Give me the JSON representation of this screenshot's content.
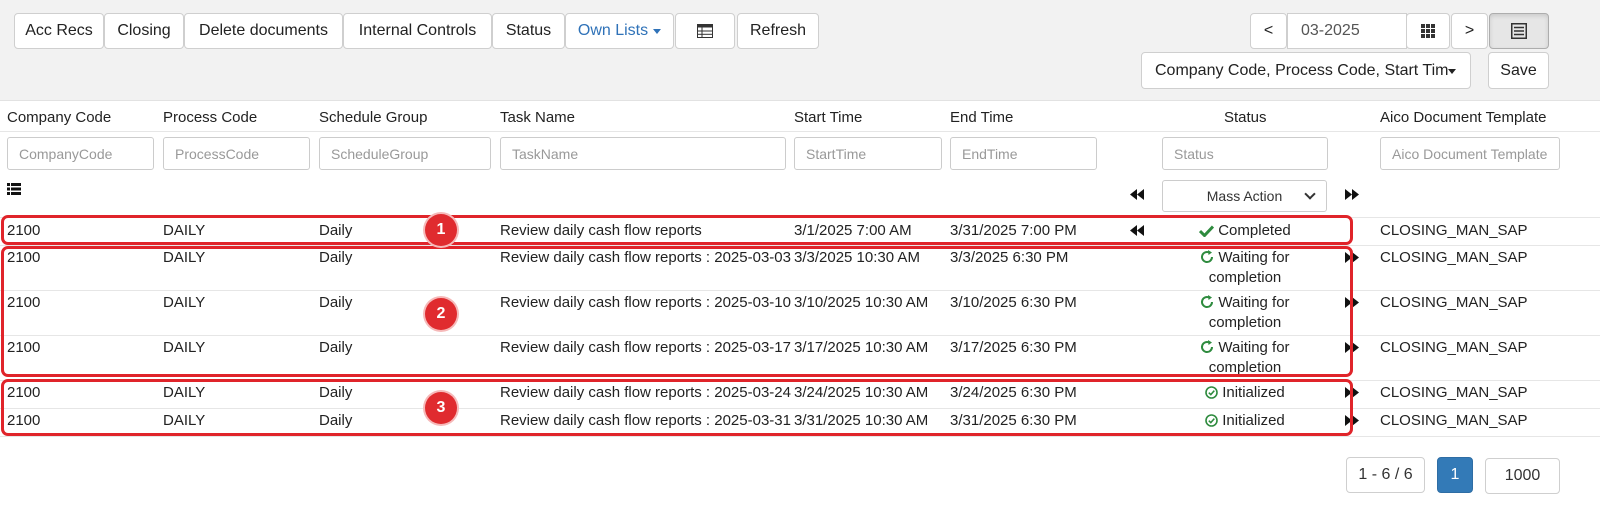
{
  "toolbar": {
    "acc_recs": "Acc Recs",
    "closing": "Closing",
    "delete_documents": "Delete documents",
    "internal_controls": "Internal Controls",
    "status": "Status",
    "own_lists": "Own Lists",
    "refresh": "Refresh",
    "prev": "<",
    "next": ">",
    "period": "03-2025",
    "columns_select": "Company Code, Process Code, Start Tim",
    "save": "Save"
  },
  "columns": {
    "company_code": "Company Code",
    "process_code": "Process Code",
    "schedule_group": "Schedule Group",
    "task_name": "Task Name",
    "start_time": "Start Time",
    "end_time": "End Time",
    "status": "Status",
    "template": "Aico Document Template"
  },
  "filters": {
    "company_code": "CompanyCode",
    "process_code": "ProcessCode",
    "schedule_group": "ScheduleGroup",
    "task_name": "TaskName",
    "start_time": "StartTime",
    "end_time": "EndTime",
    "status": "Status",
    "template": "Aico Document Template"
  },
  "mass_action": "Mass Action",
  "rows": [
    {
      "company": "2100",
      "process": "DAILY",
      "group": "Daily",
      "task": "Review daily cash flow reports",
      "start": "3/1/2025 7:00 AM",
      "end": "3/31/2025 7:00 PM",
      "status_line1": "Completed",
      "status_line2": "",
      "status_kind": "completed",
      "template": "CLOSING_MAN_SAP"
    },
    {
      "company": "2100",
      "process": "DAILY",
      "group": "Daily",
      "task": "Review daily cash flow reports : 2025-03-03",
      "start": "3/3/2025 10:30 AM",
      "end": "3/3/2025 6:30 PM",
      "status_line1": "Waiting for",
      "status_line2": "completion",
      "status_kind": "waiting",
      "template": "CLOSING_MAN_SAP"
    },
    {
      "company": "2100",
      "process": "DAILY",
      "group": "Daily",
      "task": "Review daily cash flow reports : 2025-03-10",
      "start": "3/10/2025 10:30 AM",
      "end": "3/10/2025 6:30 PM",
      "status_line1": "Waiting for",
      "status_line2": "completion",
      "status_kind": "waiting",
      "template": "CLOSING_MAN_SAP"
    },
    {
      "company": "2100",
      "process": "DAILY",
      "group": "Daily",
      "task": "Review daily cash flow reports : 2025-03-17",
      "start": "3/17/2025 10:30 AM",
      "end": "3/17/2025 6:30 PM",
      "status_line1": "Waiting for",
      "status_line2": "completion",
      "status_kind": "waiting",
      "template": "CLOSING_MAN_SAP"
    },
    {
      "company": "2100",
      "process": "DAILY",
      "group": "Daily",
      "task": "Review daily cash flow reports : 2025-03-24",
      "start": "3/24/2025 10:30 AM",
      "end": "3/24/2025 6:30 PM",
      "status_line1": "Initialized",
      "status_line2": "",
      "status_kind": "initialized",
      "template": "CLOSING_MAN_SAP"
    },
    {
      "company": "2100",
      "process": "DAILY",
      "group": "Daily",
      "task": "Review daily cash flow reports : 2025-03-31",
      "start": "3/31/2025 10:30 AM",
      "end": "3/31/2025 6:30 PM",
      "status_line1": "Initialized",
      "status_line2": "",
      "status_kind": "initialized",
      "template": "CLOSING_MAN_SAP"
    }
  ],
  "markers": [
    "1",
    "2",
    "3"
  ],
  "pagination": {
    "range": "1 - 6 / 6",
    "current_page": "1",
    "page_size": "1000"
  },
  "colors": {
    "highlight": "#e0242a",
    "status_green": "#2e8b3e",
    "link_blue": "#2f72b8",
    "page_active": "#337ab7"
  }
}
